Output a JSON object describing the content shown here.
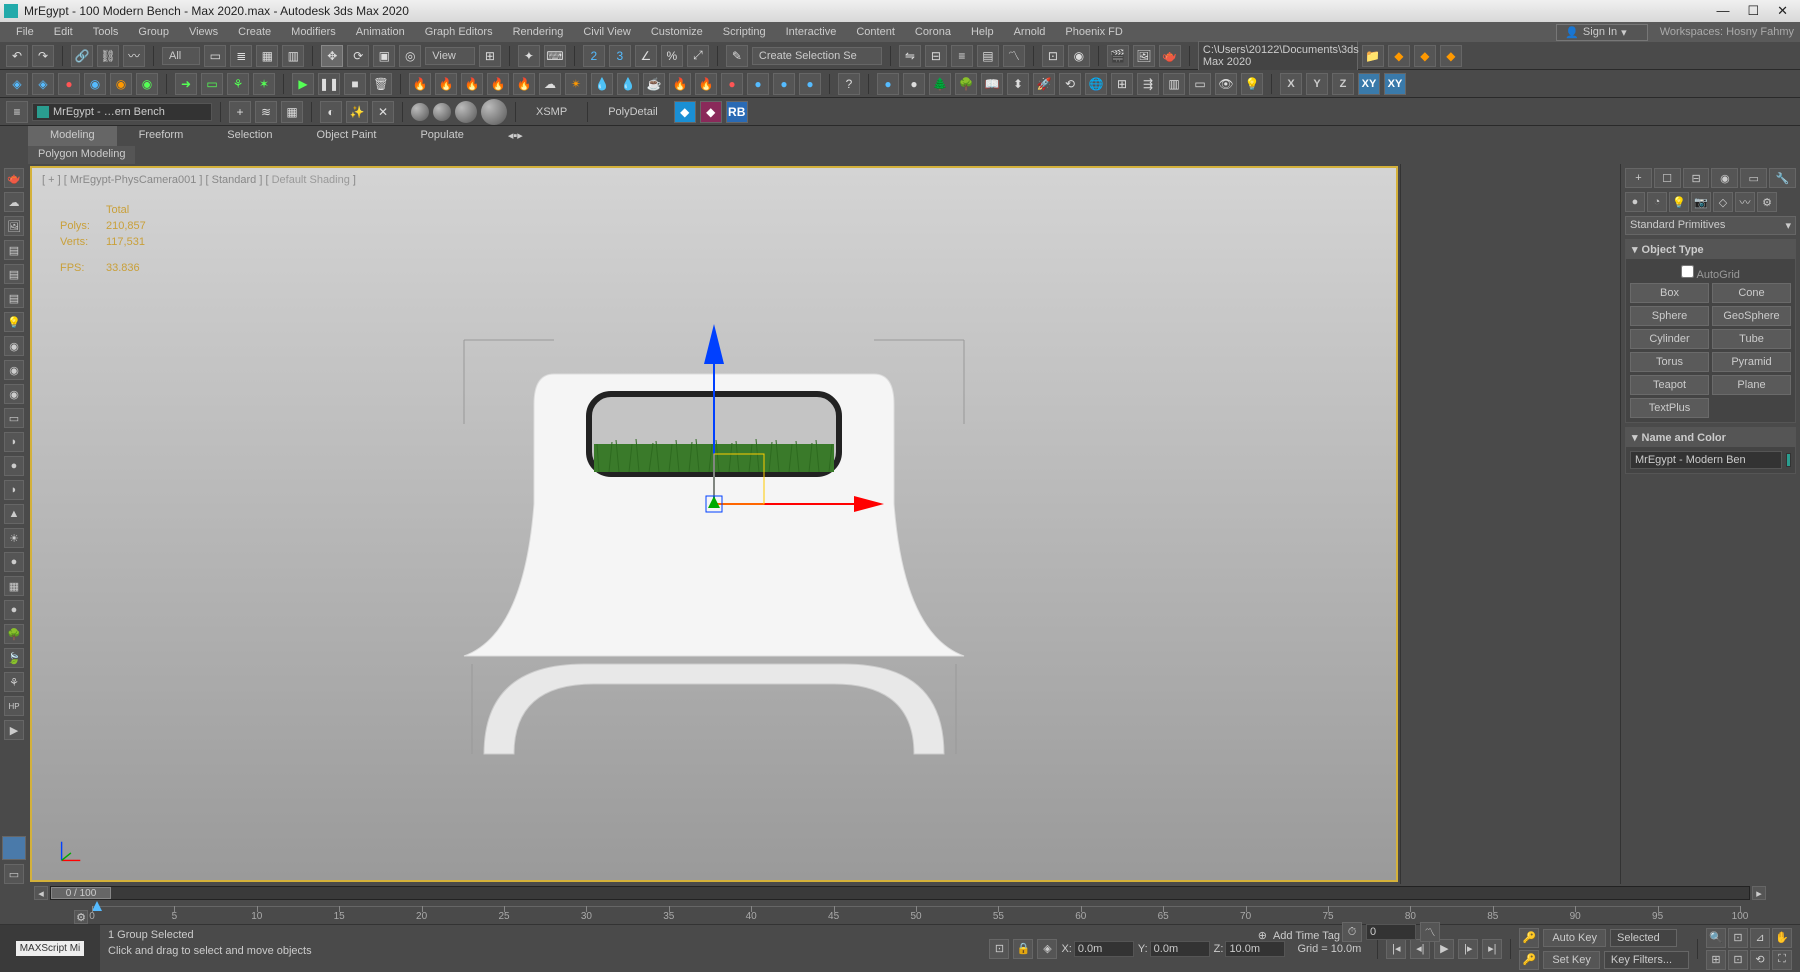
{
  "title": "MrEgypt - 100 Modern Bench - Max 2020.max - Autodesk 3ds Max 2020",
  "menus": [
    "File",
    "Edit",
    "Tools",
    "Group",
    "Views",
    "Create",
    "Modifiers",
    "Animation",
    "Graph Editors",
    "Rendering",
    "Civil View",
    "Customize",
    "Scripting",
    "Interactive",
    "Content",
    "Corona",
    "Help",
    "Arnold",
    "Phoenix FD"
  ],
  "signin": "Sign In",
  "workspaces_label": "Workspaces:",
  "workspace_value": "Hosny Fahmy",
  "toolbar2": {
    "all": "All",
    "view": "View",
    "sel_set": "Create Selection Se",
    "path": "C:\\Users\\20122\\Documents\\3ds Max 2020"
  },
  "row3": {
    "name": "MrEgypt - …ern Bench",
    "xsmp": "XSMP",
    "polydetail": "PolyDetail",
    "rb": "RB"
  },
  "ribbon_tabs": [
    "Modeling",
    "Freeform",
    "Selection",
    "Object Paint",
    "Populate"
  ],
  "ribbon_sub": "Polygon Modeling",
  "viewport": {
    "label_prefix": "[ + ] [ MrEgypt-PhysCamera001 ] [ Standard ] [ ",
    "label_shading": "Default Shading",
    "label_suffix": " ]",
    "stats": {
      "total": "Total",
      "polys_label": "Polys:",
      "polys": "210,857",
      "verts_label": "Verts:",
      "verts": "117,531",
      "fps_label": "FPS:",
      "fps": "33.836"
    }
  },
  "axes": {
    "x": "X",
    "y": "Y",
    "z": "Z",
    "xy": "XY",
    "xyz": "XY"
  },
  "command_panel": {
    "combo": "Standard Primitives",
    "object_type": "Object Type",
    "autogrid": "AutoGrid",
    "primitives": [
      [
        "Box",
        "Cone"
      ],
      [
        "Sphere",
        "GeoSphere"
      ],
      [
        "Cylinder",
        "Tube"
      ],
      [
        "Torus",
        "Pyramid"
      ],
      [
        "Teapot",
        "Plane"
      ],
      [
        "TextPlus",
        ""
      ]
    ],
    "name_and_color": "Name and Color",
    "obj_name": "MrEgypt - Modern Ben"
  },
  "time_slider": "0 / 100",
  "ruler_ticks": [
    0,
    5,
    10,
    15,
    20,
    25,
    30,
    35,
    40,
    45,
    50,
    55,
    60,
    65,
    70,
    75,
    80,
    85,
    90,
    95,
    100
  ],
  "status": {
    "sel": "1 Group Selected",
    "hint": "Click and drag to select and move objects",
    "maxscript": "MAXScript Mi",
    "x_label": "X:",
    "x": "0.0m",
    "y_label": "Y:",
    "y": "0.0m",
    "z_label": "Z:",
    "z": "10.0m",
    "grid_label": "Grid = ",
    "grid": "10.0m",
    "addtag": "Add Time Tag",
    "autokey": "Auto Key",
    "setkey": "Set Key",
    "selected": "Selected",
    "keyfilters": "Key Filters...",
    "frame": "0"
  }
}
